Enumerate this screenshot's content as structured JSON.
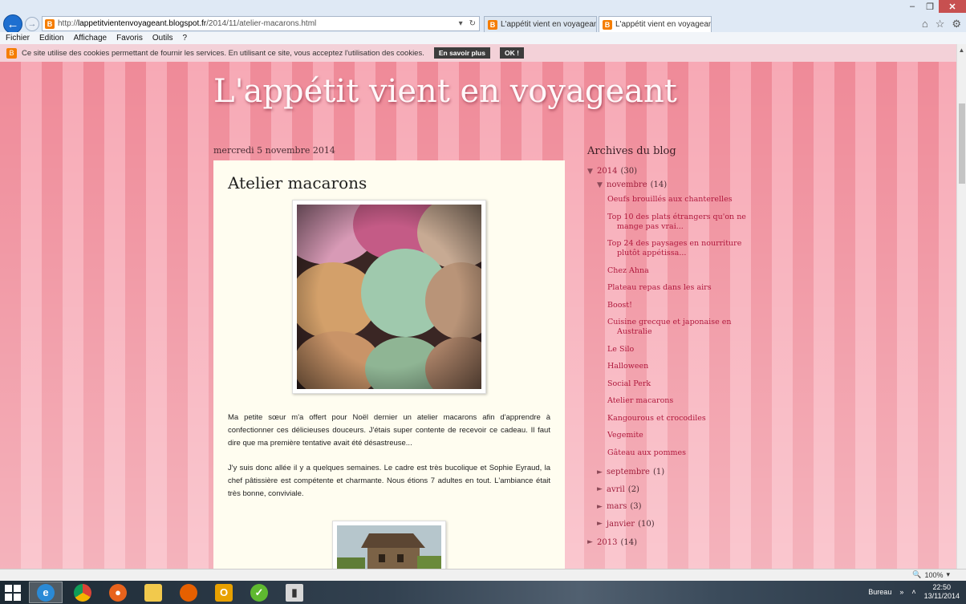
{
  "browser": {
    "url_prefix": "http://",
    "url_domain": "lappetitvientenvoyageant.blogspot.fr",
    "url_path": "/2014/11/atelier-macarons.html",
    "tabs": [
      {
        "label": "L'appétit vient en voyageant"
      },
      {
        "label": "L'appétit vient en voyagean..."
      }
    ],
    "menu": [
      "Fichier",
      "Edition",
      "Affichage",
      "Favoris",
      "Outils",
      "?"
    ]
  },
  "cookie": {
    "text": "Ce site utilise des cookies permettant de fournir les services. En utilisant ce site, vous acceptez l'utilisation des cookies.",
    "more_label": "En savoir plus",
    "ok_label": "OK !"
  },
  "blog": {
    "title": "L'appétit vient en voyageant",
    "post_date": "mercredi 5 novembre 2014",
    "post_title": "Atelier macarons",
    "paragraphs": [
      "Ma petite sœur m'a offert pour Noël dernier un atelier macarons afin d'apprendre à confectionner ces délicieuses douceurs. J'étais super contente de recevoir ce cadeau. Il faut dire que ma première tentative avait été désastreuse...",
      "J'y suis donc allée il y a quelques semaines. Le cadre est très bucolique et Sophie Eyraud, la chef pâtissière est compétente et charmante. Nous étions 7 adultes en tout. L'ambiance était très bonne, conviviale."
    ]
  },
  "sidebar": {
    "heading": "Archives du blog",
    "year_2014": {
      "toggle": "▼",
      "label": "2014",
      "count": "(30)"
    },
    "november": {
      "toggle": "▼",
      "label": "novembre",
      "count": "(14)"
    },
    "posts": [
      {
        "l1": "Oeufs brouillés aux chanterelles",
        "l2": ""
      },
      {
        "l1": "Top 10 des plats étrangers qu'on ne",
        "l2": "mange pas vrai..."
      },
      {
        "l1": "Top 24 des paysages en nourriture",
        "l2": "plutôt appétissa..."
      },
      {
        "l1": "Chez Ahna",
        "l2": ""
      },
      {
        "l1": "Plateau repas dans les airs",
        "l2": ""
      },
      {
        "l1": "Boost!",
        "l2": ""
      },
      {
        "l1": "Cuisine grecque et japonaise en",
        "l2": "Australie"
      },
      {
        "l1": "Le Silo",
        "l2": ""
      },
      {
        "l1": "Halloween",
        "l2": ""
      },
      {
        "l1": "Social Perk",
        "l2": ""
      },
      {
        "l1": "Atelier macarons",
        "l2": ""
      },
      {
        "l1": "Kangourous et crocodiles",
        "l2": ""
      },
      {
        "l1": "Vegemite",
        "l2": ""
      },
      {
        "l1": "Gâteau aux pommes",
        "l2": ""
      }
    ],
    "months": [
      {
        "toggle": "►",
        "label": "septembre",
        "count": "(1)"
      },
      {
        "toggle": "►",
        "label": "avril",
        "count": "(2)"
      },
      {
        "toggle": "►",
        "label": "mars",
        "count": "(3)"
      },
      {
        "toggle": "►",
        "label": "janvier",
        "count": "(10)"
      }
    ],
    "year_2013": {
      "toggle": "►",
      "label": "2013",
      "count": "(14)"
    }
  },
  "status": {
    "zoom": "100%"
  },
  "taskbar": {
    "desktop_label": "Bureau",
    "time": "22:50",
    "date": "13/11/2014"
  },
  "colors": {
    "accent_link": "#b0193d",
    "stripe_dark": "#ef8a98",
    "stripe_light": "#f7a9b5"
  }
}
